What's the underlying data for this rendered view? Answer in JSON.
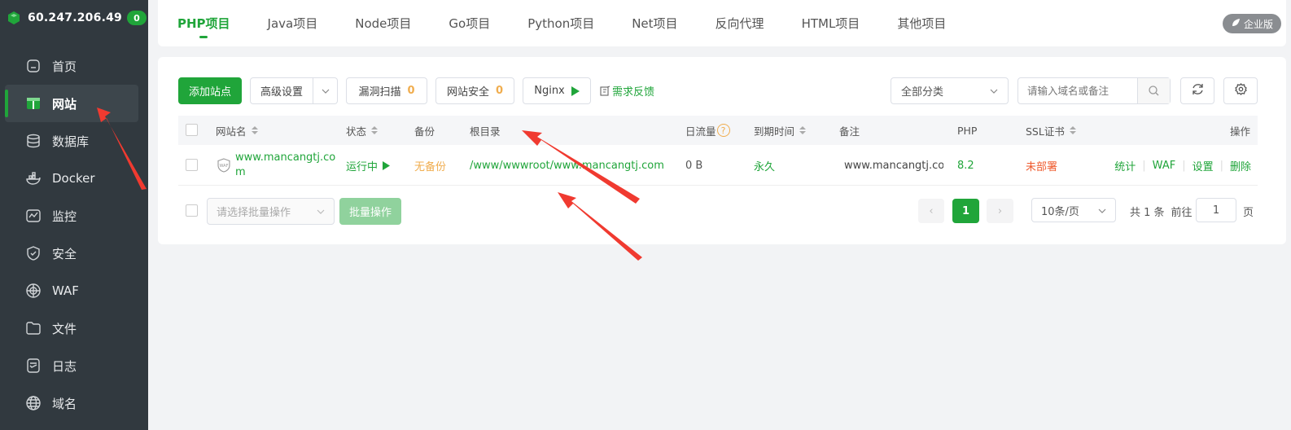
{
  "server": {
    "ip": "60.247.206.49",
    "badge": "0"
  },
  "sidebar": {
    "items": [
      {
        "label": "首页",
        "icon": "home-icon"
      },
      {
        "label": "网站",
        "icon": "website-icon",
        "active": true
      },
      {
        "label": "数据库",
        "icon": "database-icon"
      },
      {
        "label": "Docker",
        "icon": "docker-icon"
      },
      {
        "label": "监控",
        "icon": "monitor-icon"
      },
      {
        "label": "安全",
        "icon": "shield-icon"
      },
      {
        "label": "WAF",
        "icon": "waf-icon"
      },
      {
        "label": "文件",
        "icon": "folder-icon"
      },
      {
        "label": "日志",
        "icon": "log-icon"
      },
      {
        "label": "域名",
        "icon": "globe-icon"
      }
    ]
  },
  "tabs": [
    "PHP项目",
    "Java项目",
    "Node项目",
    "Go项目",
    "Python项目",
    "Net项目",
    "反向代理",
    "HTML项目",
    "其他项目"
  ],
  "enterprise_label": "企业版",
  "toolbar": {
    "add_site": "添加站点",
    "advanced": "高级设置",
    "vuln_scan": "漏洞扫描",
    "vuln_count": "0",
    "site_security": "网站安全",
    "security_count": "0",
    "nginx": "Nginx",
    "feedback": "需求反馈",
    "category": "全部分类",
    "search_placeholder": "请输入域名或备注"
  },
  "table": {
    "headers": {
      "name": "网站名",
      "status": "状态",
      "backup": "备份",
      "root": "根目录",
      "traffic": "日流量",
      "expire": "到期时间",
      "remark": "备注",
      "php": "PHP",
      "ssl": "SSL证书",
      "ops": "操作"
    },
    "rows": [
      {
        "name_line1": "www.mancangtj.co",
        "name_line2": "m",
        "status": "运行中",
        "backup": "无备份",
        "root": "/www/wwwroot/www.mancangtj.com",
        "traffic": "0 B",
        "expire": "永久",
        "remark": "www.mancangtj.com",
        "php": "8.2",
        "ssl": "未部署",
        "actions": [
          "统计",
          "WAF",
          "设置",
          "删除"
        ]
      }
    ]
  },
  "footer": {
    "batch_placeholder": "请选择批量操作",
    "batch_button": "批量操作",
    "current_page": "1",
    "page_size": "10条/页",
    "total": "共 1 条",
    "goto_label": "前往",
    "goto_value": "1",
    "page_suffix": "页"
  },
  "colors": {
    "brand": "#20a53a",
    "sidebar_bg": "#31393f",
    "warning": "#f0ad4e",
    "danger": "#ef5a2d"
  }
}
